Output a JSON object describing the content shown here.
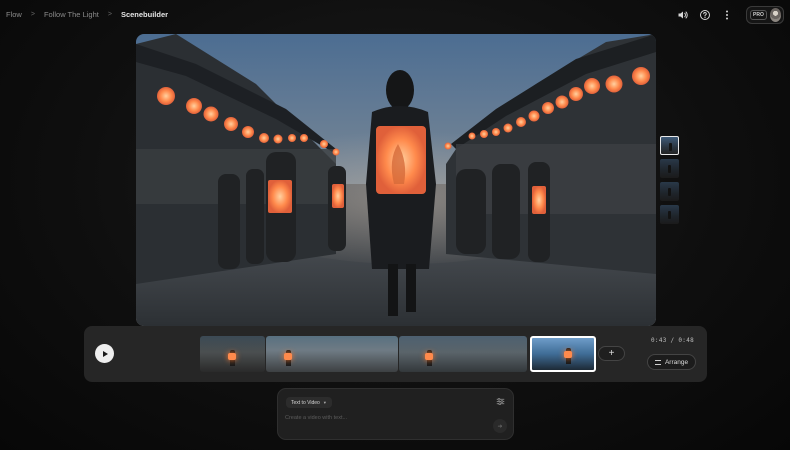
{
  "breadcrumb": {
    "items": [
      "Flow",
      "Follow The Light",
      "Scenebuilder"
    ],
    "separator": ">"
  },
  "top_actions": {
    "icons": [
      "volume-icon",
      "help-icon",
      "more-vert-icon"
    ],
    "plan_badge": "PRO"
  },
  "scene": {
    "description_icon": "video-frame",
    "shots": {
      "count": 4,
      "active_index": 0
    }
  },
  "timeline": {
    "play_icon": "play-icon",
    "clips_count": 4,
    "selected_clip_index": 3,
    "add_clip_label": "+",
    "timecode": "0:43 / 0:48",
    "arrange_label": "Arrange"
  },
  "prompt": {
    "mode_label": "Text to Video",
    "placeholder": "Create a video with text...",
    "send_icon": "arrow-right-icon",
    "settings_icon": "sliders-icon"
  },
  "colors": {
    "background": "#0f0f0f",
    "panel": "#262626",
    "lantern_glow": "#ff8a4c",
    "sky": "#4a6a8f"
  }
}
